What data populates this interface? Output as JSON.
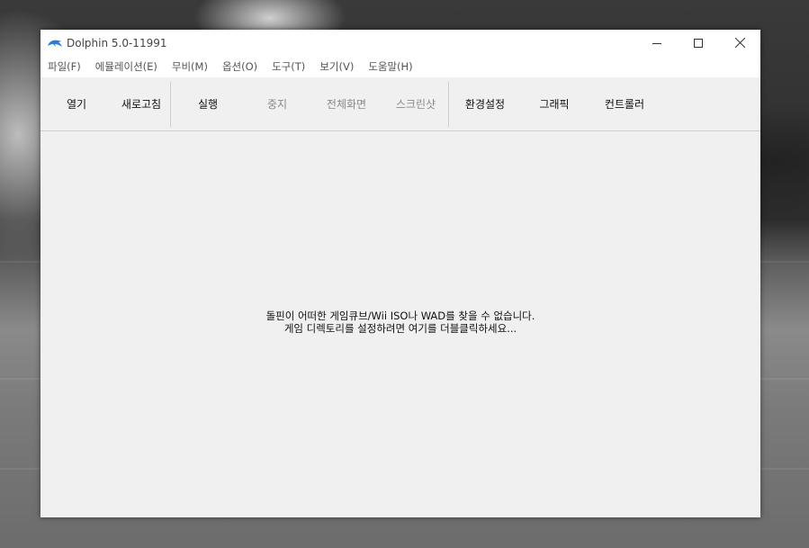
{
  "window": {
    "title": "Dolphin 5.0-11991",
    "controls": {
      "minimize": "–",
      "maximize": "☐",
      "close": "✕"
    }
  },
  "menu": [
    "파일(F)",
    "에뮬레이션(E)",
    "무비(M)",
    "옵션(O)",
    "도구(T)",
    "보기(V)",
    "도움말(H)"
  ],
  "toolbar": {
    "open": "열기",
    "refresh": "새로고침",
    "play": "실행",
    "stop": "중지",
    "fullscreen": "전체화면",
    "screenshot": "스크린샷",
    "config": "환경설정",
    "graphics": "그래픽",
    "controllers": "컨트롤러"
  },
  "game_list": {
    "empty_line1": "돌핀이 어떠한 게임큐브/Wii ISO나 WAD를 찾을 수 없습니다.",
    "empty_line2": "게임 디렉토리를 설정하려면 여기를 더블클릭하세요..."
  },
  "colors": {
    "icon_blue": "#2a7fd4",
    "window_bg": "#f0f0f0"
  },
  "icons": {
    "app": "dolphin-icon"
  }
}
